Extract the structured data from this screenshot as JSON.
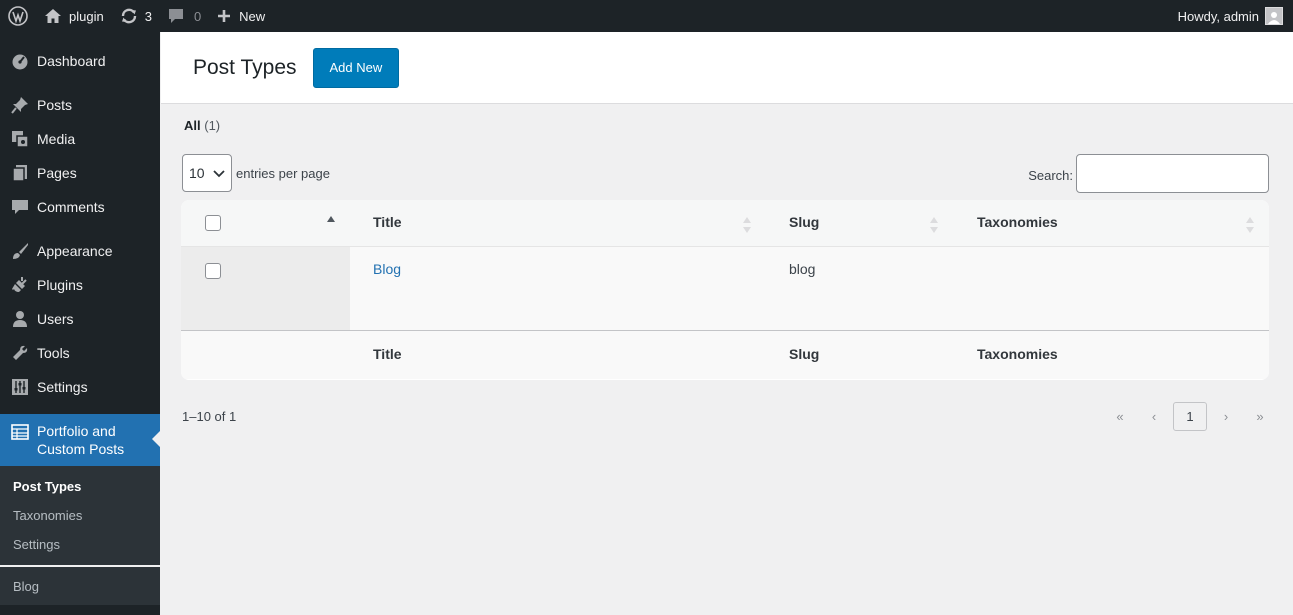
{
  "admin_bar": {
    "site_name": "plugin",
    "updates_count": "3",
    "comments_count": "0",
    "new_label": "New",
    "greeting": "Howdy, admin"
  },
  "sidebar": {
    "items": [
      {
        "label": "Dashboard",
        "icon": "dashboard-icon"
      },
      {
        "label": "Posts",
        "icon": "pin-icon"
      },
      {
        "label": "Media",
        "icon": "media-icon"
      },
      {
        "label": "Pages",
        "icon": "pages-icon"
      },
      {
        "label": "Comments",
        "icon": "comments-icon"
      },
      {
        "label": "Appearance",
        "icon": "brush-icon"
      },
      {
        "label": "Plugins",
        "icon": "plugin-icon"
      },
      {
        "label": "Users",
        "icon": "users-icon"
      },
      {
        "label": "Tools",
        "icon": "wrench-icon"
      },
      {
        "label": "Settings",
        "icon": "settings-icon"
      }
    ],
    "current": {
      "label_line1": "Portfolio and",
      "label_line2": "Custom Posts"
    },
    "submenu": [
      "Post Types",
      "Taxonomies",
      "Settings"
    ],
    "extra": "Blog"
  },
  "page": {
    "title": "Post Types",
    "add_new": "Add New",
    "filter_all": "All",
    "filter_count": "(1)",
    "per_page_value": "10",
    "per_page_label": "entries per page",
    "search_label": "Search:",
    "search_value": ""
  },
  "table": {
    "columns": [
      "Title",
      "Slug",
      "Taxonomies"
    ],
    "rows": [
      {
        "title": "Blog",
        "slug": "blog",
        "taxonomies": ""
      }
    ]
  },
  "pagination": {
    "info": "1–10 of 1",
    "first": "«",
    "prev": "‹",
    "current": "1",
    "next": "›",
    "last": "»"
  },
  "colors": {
    "admin_dark": "#1d2327",
    "accent_blue": "#2271b1",
    "button_blue": "#007cba"
  }
}
